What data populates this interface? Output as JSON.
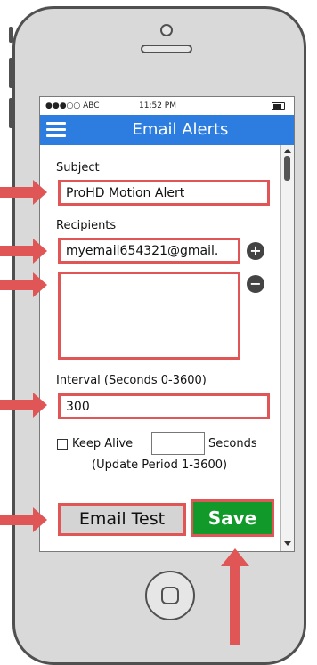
{
  "status_bar": {
    "carrier": "●●●○○ ABC",
    "time": "11:52 PM"
  },
  "header": {
    "title": "Email Alerts"
  },
  "form": {
    "subject_label": "Subject",
    "subject_value": "ProHD Motion Alert",
    "recipients_label": "Recipients",
    "recipient_value": "myemail654321@gmail.",
    "add_recipient_glyph": "+",
    "remove_recipient_glyph": "−",
    "interval_label": "Interval (Seconds 0-3600)",
    "interval_value": "300",
    "keep_alive_label": "Keep Alive",
    "keep_alive_value": "",
    "seconds_label": "Seconds",
    "update_period_label": "(Update Period 1-3600)"
  },
  "actions": {
    "email_test_label": "Email Test",
    "save_label": "Save"
  },
  "colors": {
    "nav_blue": "#2d7de0",
    "highlight_red": "#e05656",
    "save_green": "#119a2a"
  },
  "icons": [
    "hamburger-menu-icon",
    "battery-icon",
    "plus-circle-icon",
    "minus-circle-icon",
    "home-button-icon"
  ]
}
